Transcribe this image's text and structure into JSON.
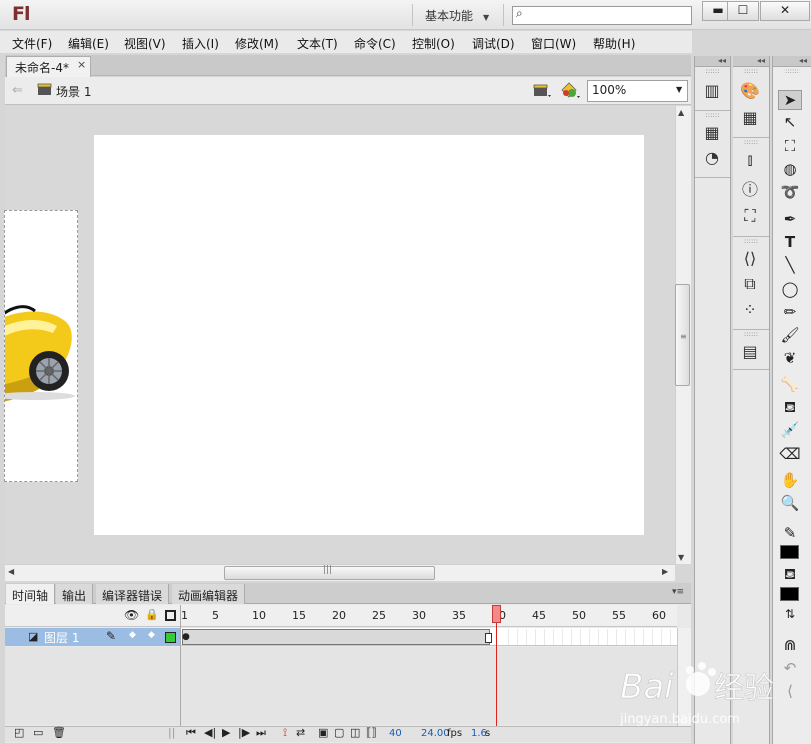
{
  "titlebar": {
    "logo": "Fl",
    "workspace": "基本功能",
    "search_placeholder": "",
    "min_glyph": "▬",
    "max_glyph": "☐",
    "close_glyph": "✕"
  },
  "menu": {
    "items": [
      "文件(F)",
      "编辑(E)",
      "视图(V)",
      "插入(I)",
      "修改(M)",
      "文本(T)",
      "命令(C)",
      "控制(O)",
      "调试(D)",
      "窗口(W)",
      "帮助(H)"
    ]
  },
  "document": {
    "tab_title": "未命名-4*",
    "tab_close": "×"
  },
  "scenebar": {
    "scene_label": "场景 1",
    "zoom": "100%"
  },
  "timeline": {
    "tabs": [
      "时间轴",
      "输出",
      "编译器错误",
      "动画编辑器"
    ],
    "ruler_labels": [
      "1",
      "5",
      "10",
      "15",
      "20",
      "25",
      "30",
      "35",
      "40",
      "45",
      "50",
      "55",
      "60"
    ],
    "layer_name": "图层 1",
    "current_frame": "40",
    "fps": "24.00",
    "fps_unit": "fps",
    "time": "1.6",
    "time_unit": "s"
  },
  "watermark": {
    "brand": "Bai",
    "brand_tail": "经验",
    "url": "jingyan.baidu.com"
  },
  "colors": {
    "logo": "#7d2f2f",
    "layer_selected": "#9bbde4",
    "playhead": "#f38a8a",
    "layer_outline": "#33cc33"
  }
}
